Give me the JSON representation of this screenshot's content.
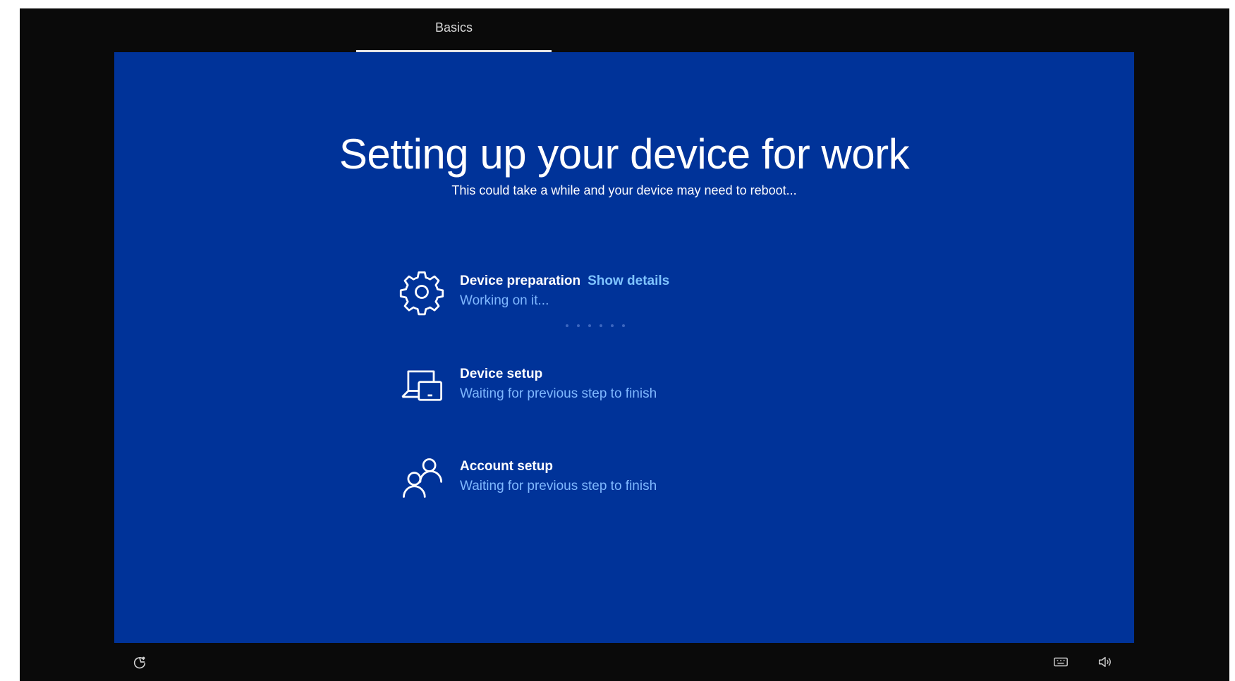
{
  "header": {
    "tab_label": "Basics"
  },
  "main": {
    "title": "Setting up your device for work",
    "subtitle": "This could take a while and your device may need to reboot..."
  },
  "steps": [
    {
      "label": "Device preparation",
      "link": "Show details",
      "status": "Working on it...",
      "icon": "gear-icon"
    },
    {
      "label": "Device setup",
      "status": "Waiting for previous step to finish",
      "icon": "device-setup-icon"
    },
    {
      "label": "Account setup",
      "status": "Waiting for previous step to finish",
      "icon": "account-icon"
    }
  ],
  "footer": {
    "left_icon": "ease-of-access-icon",
    "right_icons": [
      "keyboard-icon",
      "volume-icon"
    ]
  },
  "colors": {
    "panel_background": "#003399",
    "frame_background": "#0a0a0a",
    "status_text": "#7fb8ff",
    "link_text": "#7fc4ff"
  }
}
